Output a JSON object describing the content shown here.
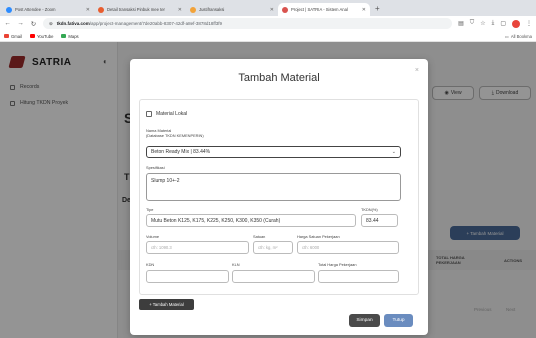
{
  "browser": {
    "tabs": [
      {
        "label": "Post Attendee - Zoom",
        "color": "#2d8cff"
      },
      {
        "label": "Detail transaksi Pinbuk mee ter",
        "color": "#e85d2f"
      },
      {
        "label": "Justifransaksi",
        "color": "#f2a33a"
      },
      {
        "label": "Project | SATRIA - Sistem Anal",
        "color": "#d9534f"
      }
    ],
    "new_tab": "+",
    "url_domain": "tkdn.fativa.com",
    "url_path": "/app/project-management/7de20abb-8307-42df-a8ef-3878d18ff3f9",
    "bookmarks": [
      {
        "label": "Gmail",
        "color": "#ea4335"
      },
      {
        "label": "YouTube",
        "color": "#ff0000"
      },
      {
        "label": "Maps",
        "color": "#34a853"
      }
    ],
    "all_bookmarks": "All Bookma"
  },
  "app": {
    "brand": "SATRIA",
    "sidebar": [
      {
        "label": "Records"
      },
      {
        "label": "Hitung TKDN Proyek"
      }
    ],
    "view_button": "View",
    "download_button": "Download",
    "tambah_material_bg": "+ Tambah Material",
    "table_headers": {
      "total": "TOTAL HARGA PEKERJAAN",
      "actions": "ACTIONS"
    },
    "bg_letters": {
      "s": "S",
      "t": "T",
      "de": "De"
    },
    "pager": {
      "prev": "Previous",
      "next": "Next"
    }
  },
  "modal": {
    "title": "Tambah Material",
    "close": "×",
    "checkbox_label": "Material Lokal",
    "nama_material_label": "Nama Material",
    "database_label": "(Database TKDN KEMENPERIN)",
    "nama_material_value": "Beton Ready Mix | 83.44%",
    "spesifikasi_label": "Spesifikasi",
    "spesifikasi_value": "Slump 10+-2",
    "tipe_label": "Tipe",
    "tipe_value": "Mutu Beton K125, K175, K225, K250, K300, K350 (Curah)",
    "tkdn_label": "TKDN(%)",
    "tkdn_value": "83.44",
    "volume_label": "Volume",
    "volume_placeholder": "cth: 1090.3",
    "satuan_label": "Satuan",
    "satuan_placeholder": "cth: kg, m²",
    "harga_label": "Harga Satuan Pekerjaan",
    "harga_placeholder": "cth: 6000",
    "kdn_label": "KDN",
    "kln_label": "KLN",
    "total_label": "Total Harga Pekerjaan",
    "add_button": "+ Tambah Material",
    "save_button": "Simpan",
    "close_button": "Tutup"
  }
}
